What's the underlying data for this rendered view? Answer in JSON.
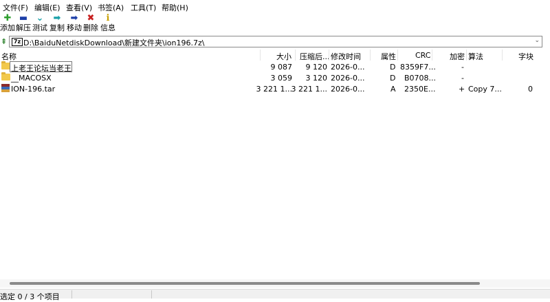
{
  "menu": [
    "文件(F)",
    "编辑(E)",
    "查看(V)",
    "书签(A)",
    "工具(T)",
    "帮助(H)"
  ],
  "toolbar": [
    {
      "label": "添加",
      "icon": "add-icon",
      "glyph": "✚",
      "color": "#2e9e2e"
    },
    {
      "label": "解压",
      "icon": "extract-icon",
      "glyph": "▬",
      "color": "#1d3fa8"
    },
    {
      "label": "测试",
      "icon": "test-icon",
      "glyph": "⌄",
      "color": "#19a0a8"
    },
    {
      "label": "复制",
      "icon": "copy-icon",
      "glyph": "➡",
      "color": "#19a0a8"
    },
    {
      "label": "移动",
      "icon": "move-icon",
      "glyph": "➡",
      "color": "#1d3fa8"
    },
    {
      "label": "删除",
      "icon": "delete-icon",
      "glyph": "✖",
      "color": "#c82020"
    },
    {
      "label": "信息",
      "icon": "info-icon",
      "glyph": "ℹ",
      "color": "#c8a000"
    }
  ],
  "address": {
    "path": "D:\\BaiduNetdiskDownload\\新建文件夹\\ion196.7z\\",
    "archive_icon": "7z"
  },
  "columns": {
    "name": "名称",
    "size": "大小",
    "packed": "压缩后...",
    "modified": "修改时间",
    "attr": "属性",
    "crc": "CRC",
    "encrypted": "加密",
    "method": "算法",
    "block": "字块"
  },
  "files": [
    {
      "type": "folder",
      "name": "上老王论坛当老王",
      "size": "9 087",
      "packed": "9 120",
      "modified": "2026-0...",
      "attr": "D",
      "crc": "8359F7...",
      "encrypted": "-",
      "method": "",
      "block": ""
    },
    {
      "type": "folder",
      "name": "__MACOSX",
      "size": "3 059",
      "packed": "3 120",
      "modified": "2026-0...",
      "attr": "D",
      "crc": "B0708...",
      "encrypted": "-",
      "method": "",
      "block": ""
    },
    {
      "type": "tar",
      "name": "ION-196.tar",
      "size": "3 221 1...",
      "packed": "3 221 1...",
      "modified": "2026-0...",
      "attr": "A",
      "crc": "2350E...",
      "encrypted": "+",
      "method": "Copy 7...",
      "block": "0"
    }
  ],
  "status": {
    "selected": "选定 0 / 3 个项目"
  }
}
